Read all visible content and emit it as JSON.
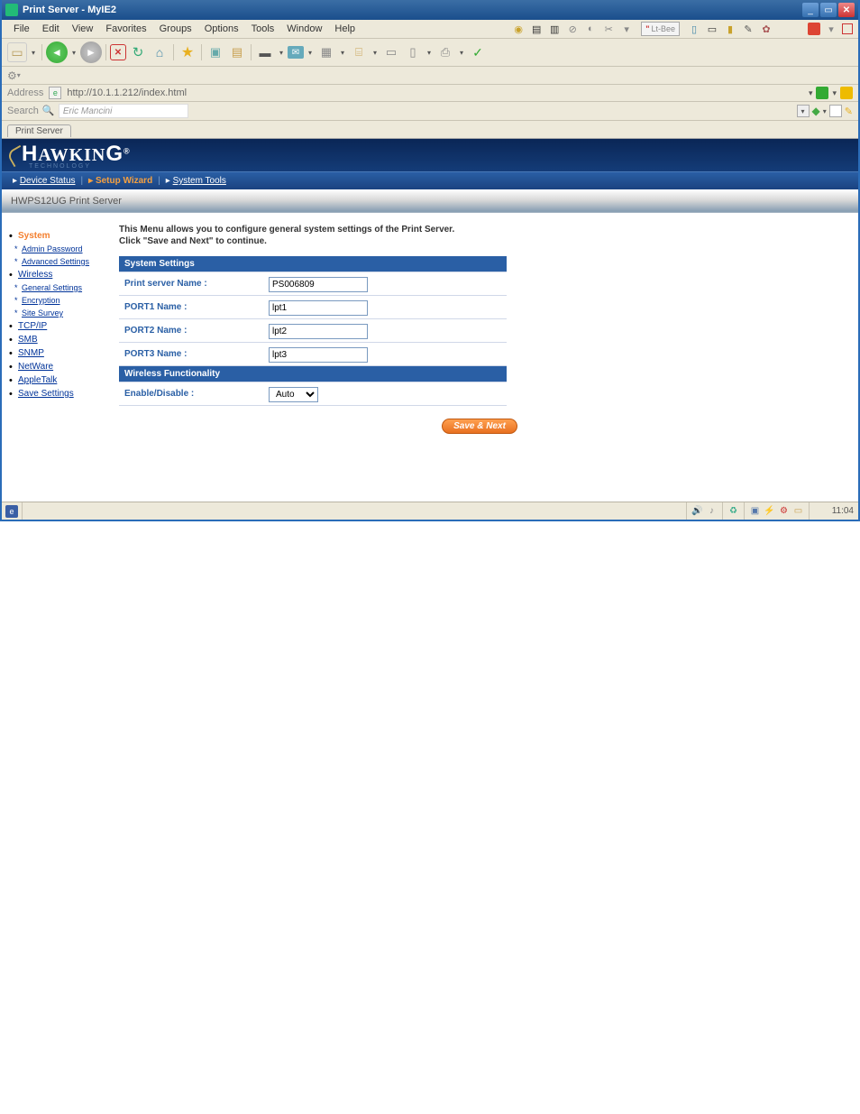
{
  "window": {
    "title": "Print Server - MyIE2"
  },
  "menubar": [
    "File",
    "Edit",
    "View",
    "Favorites",
    "Groups",
    "Options",
    "Tools",
    "Window",
    "Help"
  ],
  "rte_box": "Lt-Bee",
  "address": {
    "label": "Address",
    "url": "http://10.1.1.212/index.html"
  },
  "search": {
    "label": "Search",
    "placeholder": "Eric Mancini"
  },
  "tab": "Print Server",
  "brand": {
    "name": "HAWKING",
    "sub": "TECHNOLOGY"
  },
  "navbar": {
    "items": [
      "Device Status",
      "Setup Wizard",
      "System Tools"
    ],
    "active_index": 1,
    "prefix": "▸",
    "sep": "|"
  },
  "header_strip": "HWPS12UG Print Server",
  "sidebar": [
    {
      "label": "System",
      "type": "top"
    },
    {
      "label": "Admin Password",
      "type": "child"
    },
    {
      "label": "Advanced Settings",
      "type": "child"
    },
    {
      "label": "Wireless",
      "type": "sub"
    },
    {
      "label": "General Settings",
      "type": "child"
    },
    {
      "label": "Encryption",
      "type": "child"
    },
    {
      "label": "Site Survey",
      "type": "child"
    },
    {
      "label": "TCP/IP",
      "type": "sub"
    },
    {
      "label": "SMB",
      "type": "sub"
    },
    {
      "label": "SNMP",
      "type": "sub"
    },
    {
      "label": "NetWare",
      "type": "sub"
    },
    {
      "label": "AppleTalk",
      "type": "sub"
    },
    {
      "label": "Save Settings",
      "type": "sub"
    }
  ],
  "intro": [
    "This Menu allows you to configure general system settings of the Print Server.",
    "Click \"Save and Next\" to continue."
  ],
  "system_settings": {
    "header": "System Settings",
    "rows": [
      {
        "label": "Print server Name :",
        "value": "PS006809"
      },
      {
        "label": "PORT1 Name :",
        "value": "lpt1"
      },
      {
        "label": "PORT2 Name :",
        "value": "lpt2"
      },
      {
        "label": "PORT3 Name :",
        "value": "lpt3"
      }
    ]
  },
  "wireless": {
    "header": "Wireless Functionality",
    "label": "Enable/Disable :",
    "value": "Auto"
  },
  "save_next": "Save & Next",
  "statusbar": {
    "time": "11:04"
  }
}
